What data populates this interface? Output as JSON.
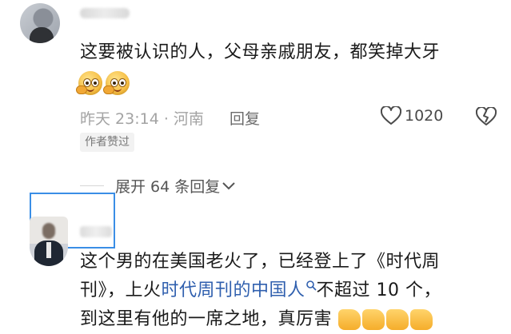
{
  "comments": [
    {
      "text": "这要被认识的人，父母亲戚朋友，都笑掉大牙",
      "emojis": [
        "grinning-face-emoji",
        "grinning-face-emoji"
      ],
      "meta": "昨天 23:14 · 河南",
      "reply_label": "回复",
      "like_count": "1020",
      "author_liked_badge": "作者赞过",
      "expand_replies": "展开 64 条回复"
    },
    {
      "line1": "这个男的在美国老火了，已经登上了《时代周",
      "line2_prefix": "刊》，上火",
      "line2_link": "时代周刊的中国人",
      "line2_suffix": "不超过 10 个，",
      "line3": "到这里有他的一席之地，真厉害"
    }
  ],
  "colors": {
    "link": "#2f5fae",
    "highlight_box": "#3a8ee6",
    "meta_gray": "#a3a3a3"
  }
}
